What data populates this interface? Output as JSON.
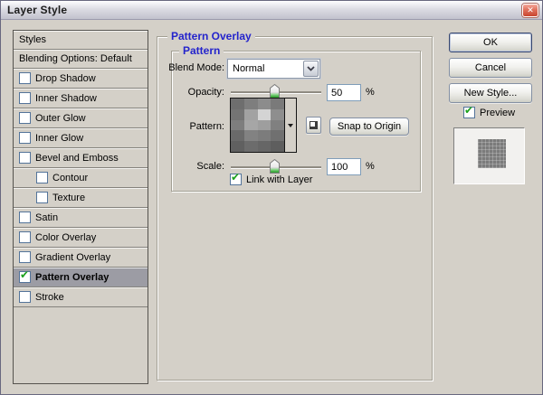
{
  "window": {
    "title": "Layer Style",
    "close_glyph": "✕"
  },
  "sidebar": {
    "styles_header": "Styles",
    "blending_row": "Blending Options: Default",
    "items": [
      {
        "label": "Drop Shadow",
        "checked": false,
        "indent": false,
        "selected": false
      },
      {
        "label": "Inner Shadow",
        "checked": false,
        "indent": false,
        "selected": false
      },
      {
        "label": "Outer Glow",
        "checked": false,
        "indent": false,
        "selected": false
      },
      {
        "label": "Inner Glow",
        "checked": false,
        "indent": false,
        "selected": false
      },
      {
        "label": "Bevel and Emboss",
        "checked": false,
        "indent": false,
        "selected": false
      },
      {
        "label": "Contour",
        "checked": false,
        "indent": true,
        "selected": false
      },
      {
        "label": "Texture",
        "checked": false,
        "indent": true,
        "selected": false
      },
      {
        "label": "Satin",
        "checked": false,
        "indent": false,
        "selected": false
      },
      {
        "label": "Color Overlay",
        "checked": false,
        "indent": false,
        "selected": false
      },
      {
        "label": "Gradient Overlay",
        "checked": false,
        "indent": false,
        "selected": false
      },
      {
        "label": "Pattern Overlay",
        "checked": true,
        "indent": false,
        "selected": true
      },
      {
        "label": "Stroke",
        "checked": false,
        "indent": false,
        "selected": false
      }
    ]
  },
  "panel": {
    "group_title": "Pattern Overlay",
    "subgroup_title": "Pattern",
    "blend_mode_label": "Blend Mode:",
    "blend_mode_value": "Normal",
    "opacity_label": "Opacity:",
    "opacity_value": "50",
    "opacity_unit": "%",
    "pattern_label": "Pattern:",
    "snap_button": "Snap to Origin",
    "scale_label": "Scale:",
    "scale_value": "100",
    "scale_unit": "%",
    "link_label": "Link with Layer",
    "link_checked": true
  },
  "actions": {
    "ok": "OK",
    "cancel": "Cancel",
    "new_style": "New Style...",
    "preview": "Preview",
    "preview_checked": true
  },
  "colors": {
    "accent_blue": "#2424cc",
    "check_green": "#1ca11c",
    "selected_row": "#9c9ca4"
  },
  "pattern_swatch": {
    "rows": [
      [
        "#6e6e6e",
        "#7e7e7e",
        "#8c8c8c",
        "#7a7a7a"
      ],
      [
        "#747474",
        "#a2a2a2",
        "#d4d4d4",
        "#8e8e8e"
      ],
      [
        "#7e7e7e",
        "#a6a6a6",
        "#9e9e9e",
        "#808080"
      ],
      [
        "#6a6a6a",
        "#828282",
        "#7c7c7c",
        "#707070"
      ],
      [
        "#606060",
        "#6c6c6c",
        "#666666",
        "#5e5e5e"
      ]
    ]
  }
}
